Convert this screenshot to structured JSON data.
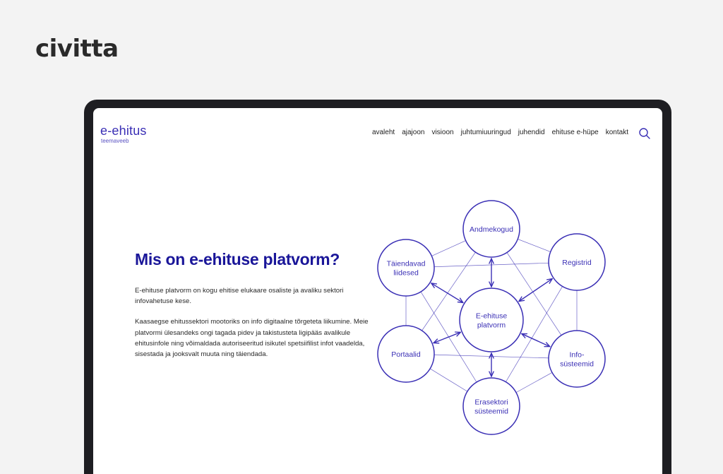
{
  "brand": {
    "logo_text": "civitta"
  },
  "site": {
    "logo_title": "e-ehitus",
    "logo_subtitle": "teemaveeb",
    "nav": [
      "avaleht",
      "ajajoon",
      "visioon",
      "juhtumiuuringud",
      "juhendid",
      "ehituse e-hüpe",
      "kontakt"
    ],
    "search_icon": "search-icon"
  },
  "hero": {
    "title": "Mis on e-ehituse platvorm?",
    "paragraph1": "E-ehituse platvorm on kogu ehitise elukaare osaliste ja avaliku sektori infovahetuse kese.",
    "paragraph2": "Kaasaegse ehitussektori mootoriks on info digitaalne tõrgeteta liikumine. Meie platvormi ülesandeks ongi tagada pidev ja takistusteta ligipääs avalikule ehitusinfole ning võimaldada autoriseeritud isikutel spetsiifilist infot vaadelda, sisestada ja jooksvalt muuta ning täiendada."
  },
  "diagram": {
    "center": [
      "E-ehituse",
      "platvorm"
    ],
    "nodes": [
      {
        "id": "andmekogud",
        "lines": [
          "Andmekogud"
        ]
      },
      {
        "id": "registrid",
        "lines": [
          "Registrid"
        ]
      },
      {
        "id": "infosusteemid",
        "lines": [
          "Info-",
          "süsteemid"
        ]
      },
      {
        "id": "erasektori",
        "lines": [
          "Erasektori",
          "süsteemid"
        ]
      },
      {
        "id": "portaalid",
        "lines": [
          "Portaalid"
        ]
      },
      {
        "id": "taiendavad",
        "lines": [
          "Täiendavad",
          "liidesed"
        ]
      }
    ],
    "accent_color": "#3a2fb5"
  }
}
